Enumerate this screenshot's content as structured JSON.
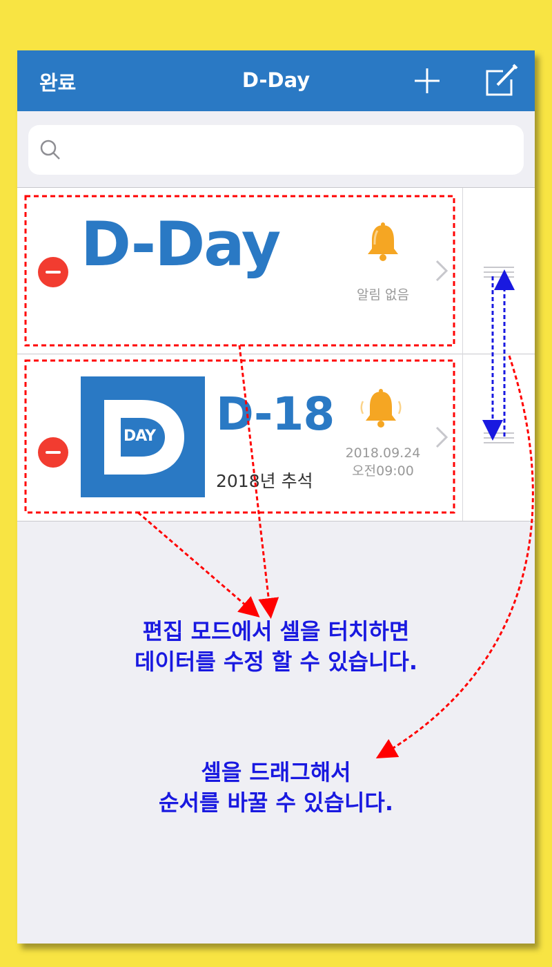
{
  "navbar": {
    "done_label": "완료",
    "title": "D-Day",
    "add_icon": "plus-icon",
    "edit_icon": "compose-icon",
    "background": "#2a79c4"
  },
  "search": {
    "placeholder": "",
    "icon": "search-icon"
  },
  "items": [
    {
      "title": "D-Day",
      "alarm_icon": "bell-icon",
      "alarm_text": "알림 없음"
    },
    {
      "thumbnail_text": "DAY",
      "title": "D-18",
      "subtitle": "2018년 추석",
      "alarm_icon": "bell-ringing-icon",
      "alarm_date": "2018.09.24",
      "alarm_time": "오전09:00"
    }
  ],
  "annotations": {
    "edit_note_line1": "편집 모드에서 셀을 터치하면",
    "edit_note_line2": "데이터를 수정 할 수 있습니다.",
    "drag_note_line1": "셀을 드래그해서",
    "drag_note_line2": "순서를 바꿀 수 있습니다.",
    "text_color": "#1919e0",
    "marker_color": "#ff0000"
  },
  "colors": {
    "background": "#f8e443",
    "accent": "#2a79c4",
    "delete": "#f23c30",
    "bell": "#f5a623"
  }
}
